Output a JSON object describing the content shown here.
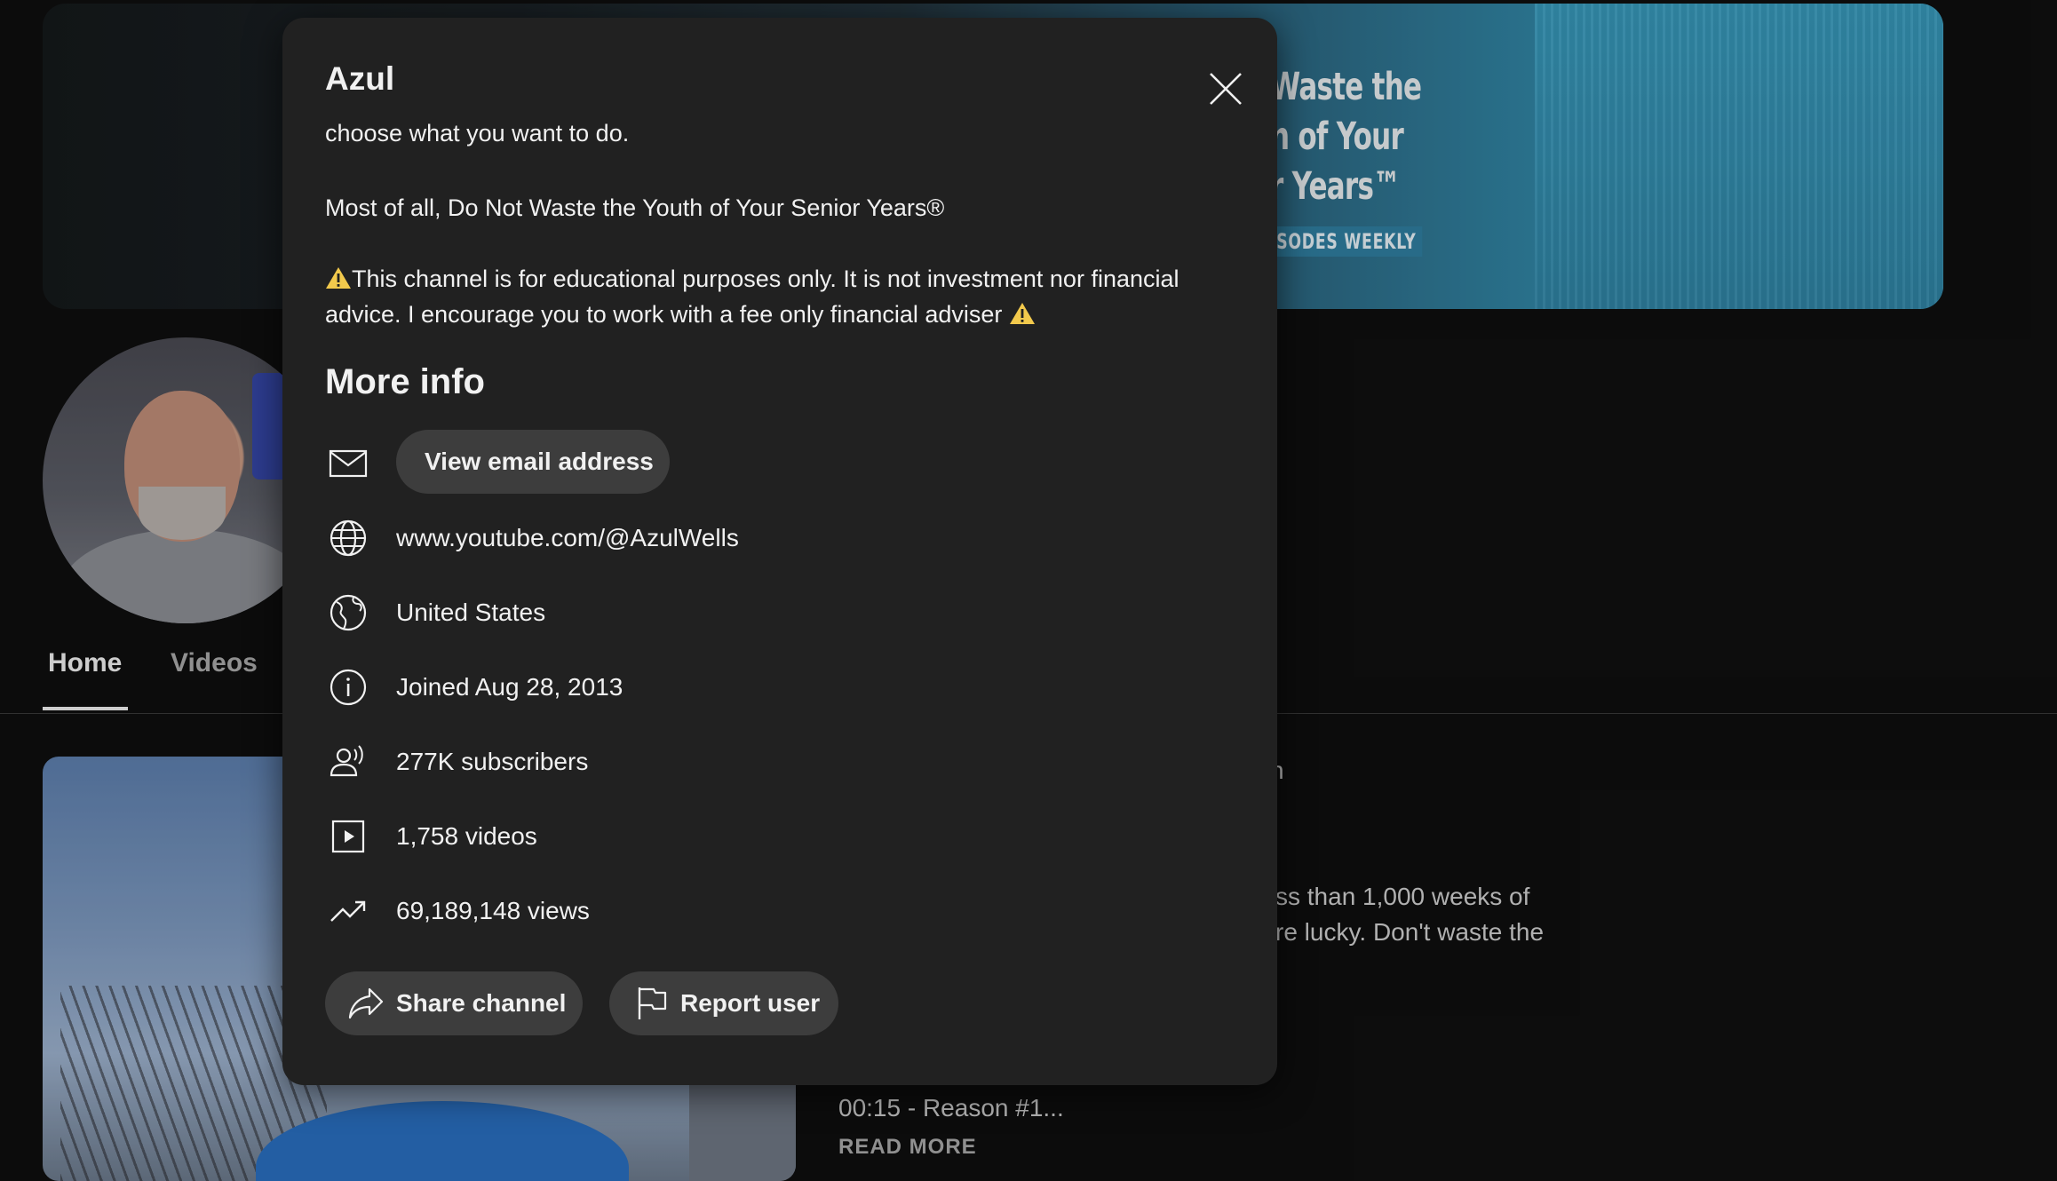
{
  "background": {
    "banner": {
      "lines": [
        "Waste the",
        "n of Your",
        "r Years™"
      ],
      "badge": "SODES WEEKLY"
    },
    "tabs": [
      {
        "label": "Home",
        "active": true
      },
      {
        "label": "Videos",
        "active": false
      }
    ],
    "video": {
      "title_fragment": "n",
      "desc_line_1": "ss than 1,000 weeks of",
      "desc_line_2": "re lucky.  Don't waste the",
      "timestamp": "00:15 - Reason #1...",
      "read_more": "READ MORE"
    }
  },
  "dialog": {
    "title": "Azul",
    "description": {
      "clipped_line": "choose what you want to do.",
      "paragraph_2": "Most of all, Do Not Waste the Youth of Your Senior Years®",
      "paragraph_3_line_1": "This channel is for educational purposes only. It is not investment nor financial",
      "paragraph_3_line_2": "advice. I encourage you to work with a fee only financial adviser"
    },
    "more_info_heading": "More info",
    "view_email_label": "View email address",
    "rows": {
      "link": "www.youtube.com/@AzulWells",
      "country": "United States",
      "joined": "Joined Aug 28, 2013",
      "subscribers": "277K subscribers",
      "videos": "1,758 videos",
      "views": "69,189,148 views"
    },
    "share_label": "Share channel",
    "report_label": "Report user"
  },
  "icons": {
    "close": "close-icon",
    "email": "mail-icon",
    "link": "globe-icon",
    "country": "globe-americas-icon",
    "joined": "info-icon",
    "subscribers": "person-radiating-icon",
    "videos": "play-box-icon",
    "views": "trending-up-icon",
    "share": "share-arrow-icon",
    "report": "flag-icon",
    "warning": "warning-icon"
  },
  "colors": {
    "dialog_bg": "#212121",
    "page_bg": "#0f0f0f",
    "button_bg": "#3d3d3d",
    "warning": "#f2c94c"
  }
}
